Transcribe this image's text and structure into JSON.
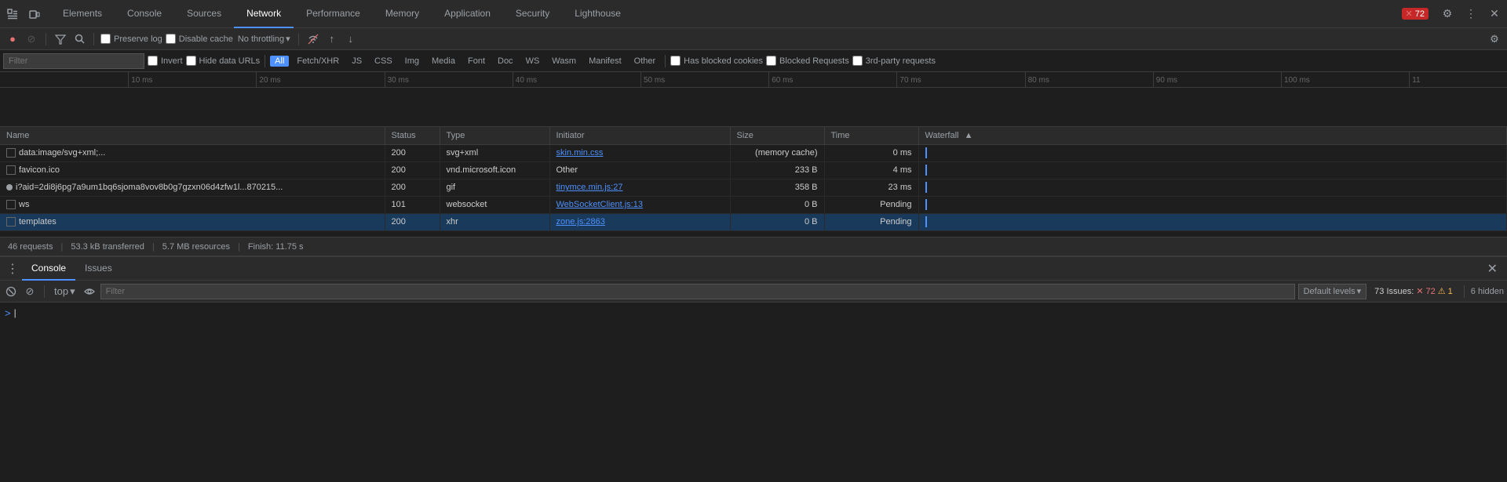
{
  "tabs": {
    "items": [
      {
        "label": "Elements",
        "active": false
      },
      {
        "label": "Console",
        "active": false
      },
      {
        "label": "Sources",
        "active": false
      },
      {
        "label": "Network",
        "active": true
      },
      {
        "label": "Performance",
        "active": false
      },
      {
        "label": "Memory",
        "active": false
      },
      {
        "label": "Application",
        "active": false
      },
      {
        "label": "Security",
        "active": false
      },
      {
        "label": "Lighthouse",
        "active": false
      }
    ],
    "error_badge": "72",
    "settings_icon": "⚙",
    "more_icon": "⋮",
    "dock_icon": "⊡",
    "inspect_icon": "⛶"
  },
  "toolbar": {
    "record_label": "●",
    "stop_label": "⊘",
    "filter_label": "⊙",
    "search_label": "🔍",
    "preserve_log": "Preserve log",
    "disable_cache": "Disable cache",
    "throttle": "No throttling",
    "upload_icon": "↑",
    "download_icon": "↓",
    "settings_icon": "⚙"
  },
  "filter_bar": {
    "placeholder": "Filter",
    "invert": "Invert",
    "hide_data_urls": "Hide data URLs",
    "all": "All",
    "fetch_xhr": "Fetch/XHR",
    "js": "JS",
    "css": "CSS",
    "img": "Img",
    "media": "Media",
    "font": "Font",
    "doc": "Doc",
    "ws": "WS",
    "wasm": "Wasm",
    "manifest": "Manifest",
    "other": "Other",
    "has_blocked_cookies": "Has blocked cookies",
    "blocked_requests": "Blocked Requests",
    "third_party": "3rd-party requests"
  },
  "timeline": {
    "ticks": [
      {
        "label": "10 ms",
        "pos_pct": 8.5
      },
      {
        "label": "20 ms",
        "pos_pct": 17
      },
      {
        "label": "30 ms",
        "pos_pct": 25.5
      },
      {
        "label": "40 ms",
        "pos_pct": 34
      },
      {
        "label": "50 ms",
        "pos_pct": 42.5
      },
      {
        "label": "60 ms",
        "pos_pct": 51
      },
      {
        "label": "70 ms",
        "pos_pct": 59.5
      },
      {
        "label": "80 ms",
        "pos_pct": 68
      },
      {
        "label": "90 ms",
        "pos_pct": 76.5
      },
      {
        "label": "100 ms",
        "pos_pct": 85
      },
      {
        "label": "11",
        "pos_pct": 93
      }
    ]
  },
  "table": {
    "columns": [
      {
        "label": "Name",
        "key": "name"
      },
      {
        "label": "Status",
        "key": "status"
      },
      {
        "label": "Type",
        "key": "type"
      },
      {
        "label": "Initiator",
        "key": "initiator"
      },
      {
        "label": "Size",
        "key": "size"
      },
      {
        "label": "Time",
        "key": "time"
      },
      {
        "label": "Waterfall",
        "key": "waterfall"
      }
    ],
    "rows": [
      {
        "name": "data:image/svg+xml;...",
        "status": "200",
        "type": "svg+xml",
        "initiator": "skin.min.css",
        "initiator_link": true,
        "size": "(memory cache)",
        "time": "0 ms",
        "has_icon": true
      },
      {
        "name": "favicon.ico",
        "status": "200",
        "type": "vnd.microsoft.icon",
        "initiator": "Other",
        "initiator_link": false,
        "size": "233 B",
        "time": "4 ms",
        "has_icon": true
      },
      {
        "name": "i?aid=2di8j6pg7a9um1bq6sjoma8vov8b0g7gzxn06d4zfw1l...870215...",
        "status": "200",
        "type": "gif",
        "initiator": "tinymce.min.js:27",
        "initiator_link": true,
        "size": "358 B",
        "time": "23 ms",
        "has_icon": false,
        "dot": true
      },
      {
        "name": "ws",
        "status": "101",
        "type": "websocket",
        "initiator": "WebSocketClient.js:13",
        "initiator_link": true,
        "size": "0 B",
        "time": "Pending",
        "has_icon": true
      },
      {
        "name": "templates",
        "status": "200",
        "type": "xhr",
        "initiator": "zone.js:2863",
        "initiator_link": true,
        "size": "0 B",
        "time": "Pending",
        "has_icon": true
      }
    ]
  },
  "status_bar": {
    "requests": "46 requests",
    "transferred": "53.3 kB transferred",
    "resources": "5.7 MB resources",
    "finish": "Finish: 11.75 s"
  },
  "console": {
    "tabs": [
      {
        "label": "Console",
        "active": true
      },
      {
        "label": "Issues",
        "active": false
      }
    ],
    "context": "top",
    "filter_placeholder": "Filter",
    "levels": "Default levels",
    "issues_count": "73 Issues:",
    "error_count": "72",
    "warning_count": "1",
    "hidden_count": "6 hidden",
    "prompt": ">"
  }
}
